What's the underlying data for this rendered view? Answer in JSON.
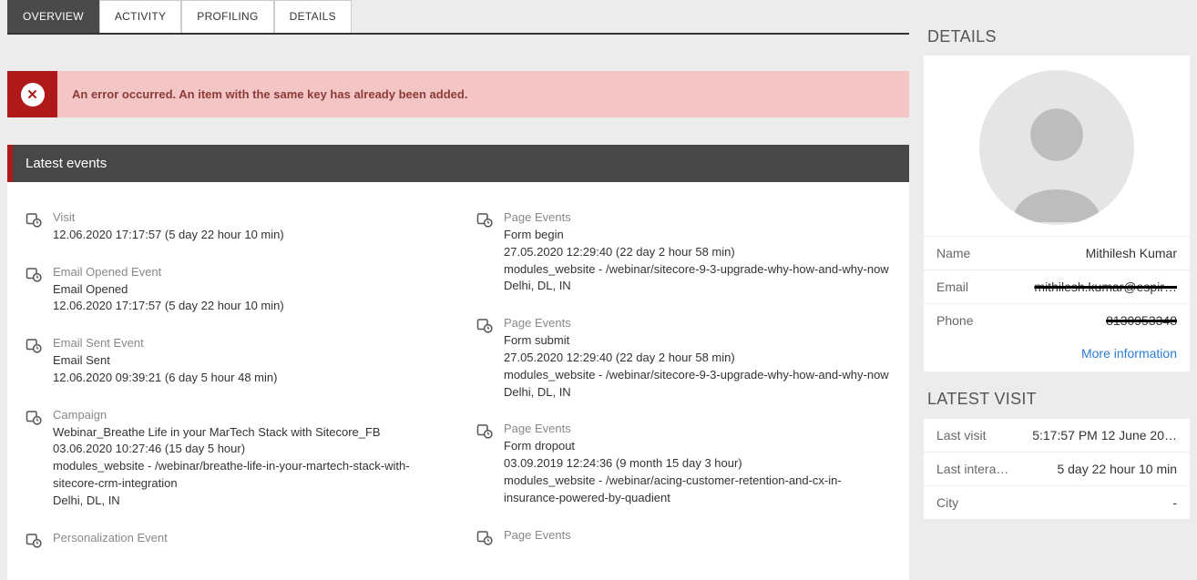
{
  "tabs": {
    "overview": "OVERVIEW",
    "activity": "ACTIVITY",
    "profiling": "PROFILING",
    "details": "DETAILS"
  },
  "alert": {
    "message": "An error occurred. An item with the same key has already been added."
  },
  "panel": {
    "title": "Latest events"
  },
  "left": {
    "e0": {
      "label": "Visit",
      "l1": "12.06.2020 17:17:57 (5 day 22 hour 10 min)"
    },
    "e1": {
      "label": "Email Opened Event",
      "l1": "Email Opened",
      "l2": "12.06.2020 17:17:57 (5 day 22 hour 10 min)"
    },
    "e2": {
      "label": "Email Sent Event",
      "l1": "Email Sent",
      "l2": "12.06.2020 09:39:21 (6 day 5 hour 48 min)"
    },
    "e3": {
      "label": "Campaign",
      "l1": "Webinar_Breathe Life in your MarTech Stack with Sitecore_FB",
      "l2": "03.06.2020 10:27:46 (15 day 5 hour)",
      "l3": "modules_website - /webinar/breathe-life-in-your-martech-stack-with-sitecore-crm-integration",
      "l4": "Delhi, DL, IN"
    },
    "e4": {
      "label": "Personalization Event"
    }
  },
  "right": {
    "e0": {
      "label": "Page Events",
      "l1": "Form begin",
      "l2": "27.05.2020 12:29:40 (22 day 2 hour 58 min)",
      "l3": "modules_website - /webinar/sitecore-9-3-upgrade-why-how-and-why-now",
      "l4": "Delhi, DL, IN"
    },
    "e1": {
      "label": "Page Events",
      "l1": "Form submit",
      "l2": "27.05.2020 12:29:40 (22 day 2 hour 58 min)",
      "l3": "modules_website - /webinar/sitecore-9-3-upgrade-why-how-and-why-now",
      "l4": "Delhi, DL, IN"
    },
    "e2": {
      "label": "Page Events",
      "l1": "Form dropout",
      "l2": "03.09.2019 12:24:36 (9 month 15 day 3 hour)",
      "l3": "modules_website - /webinar/acing-customer-retention-and-cx-in-insurance-powered-by-quadient"
    },
    "e3": {
      "label": "Page Events"
    }
  },
  "details": {
    "heading": "DETAILS",
    "name_k": "Name",
    "name_v": "Mithilesh Kumar",
    "email_k": "Email",
    "email_v": "mithilesh.kumar@espir…",
    "phone_k": "Phone",
    "phone_v": "8130953348",
    "more": "More information"
  },
  "visit": {
    "heading": "LATEST VISIT",
    "last_visit_k": "Last visit",
    "last_visit_v": "5:17:57 PM 12 June 20…",
    "last_inter_k": "Last intera…",
    "last_inter_v": "5 day 22 hour 10 min",
    "city_k": "City",
    "city_v": "-"
  }
}
